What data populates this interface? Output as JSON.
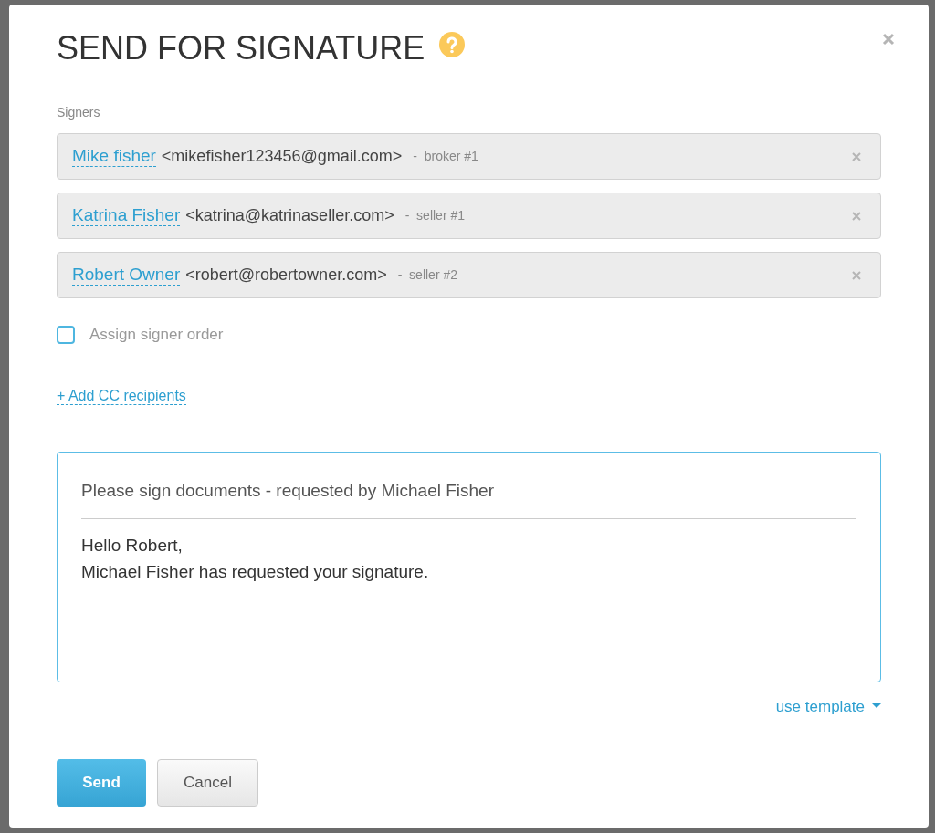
{
  "dialog": {
    "title": "SEND FOR SIGNATURE",
    "signers_label": "Signers",
    "signers": [
      {
        "name": "Mike fisher",
        "email": "<mikefisher123456@gmail.com>",
        "role": "-  broker #1"
      },
      {
        "name": "Katrina Fisher",
        "email": "<katrina@katrinaseller.com>",
        "role": "-  seller #1"
      },
      {
        "name": "Robert Owner",
        "email": "<robert@robertowner.com>",
        "role": "-  seller #2"
      }
    ],
    "assign_order": {
      "label": "Assign signer order",
      "checked": false
    },
    "add_cc": "+ Add CC recipients",
    "message": {
      "subject": "Please sign documents - requested by Michael Fisher",
      "body": [
        "Hello Robert,",
        "Michael Fisher has requested your signature."
      ]
    },
    "use_template": "use template",
    "buttons": {
      "send": "Send",
      "cancel": "Cancel"
    }
  }
}
